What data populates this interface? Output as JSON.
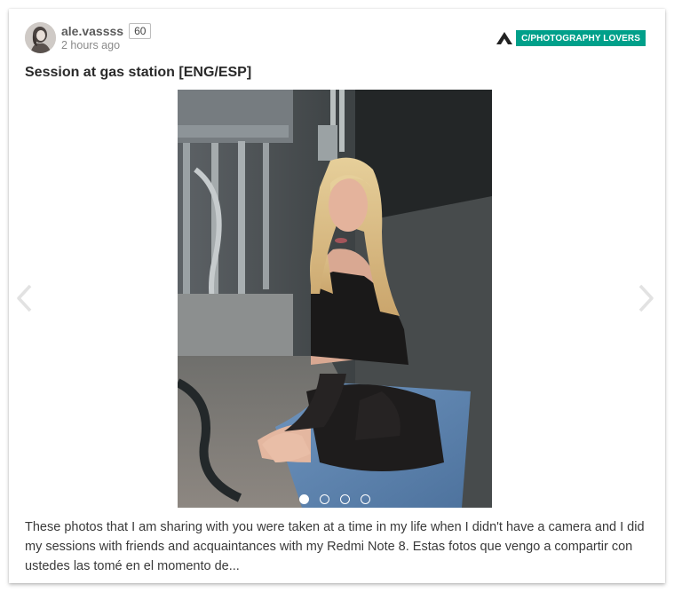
{
  "post": {
    "author": "ale.vassss",
    "reputation": "60",
    "timestamp": "2 hours ago",
    "community": "C/PHOTOGRAPHY LOVERS",
    "title": "Session at gas station [ENG/ESP]",
    "excerpt": "These photos that I am sharing with you were taken at a time in my life when I didn't have a camera and I did my sessions with friends and acquaintances with my Redmi Note 8. Estas fotos que vengo a compartir con ustedes las tomé en el momento de..."
  },
  "carousel": {
    "slide_count": 4,
    "active_index": 0
  },
  "icons": {
    "community": "community-logo-icon",
    "prev": "chevron-left-icon",
    "next": "chevron-right-icon"
  },
  "colors": {
    "community_tag": "#00a08a",
    "title": "#2a2a2a",
    "body_text": "#3a3a3a"
  }
}
